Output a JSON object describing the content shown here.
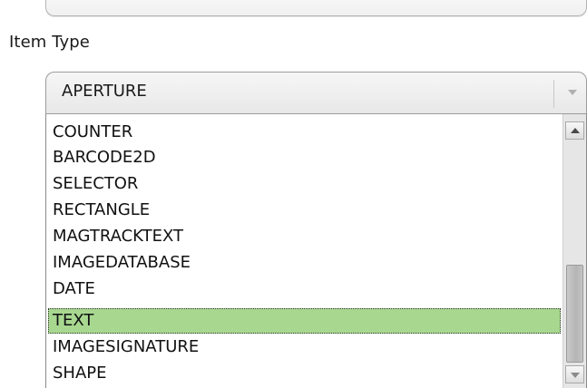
{
  "item_type": {
    "label": "Item Type",
    "selected_value": "APERTURE",
    "icons": {
      "dropdown": "chevron-down-icon",
      "scroll_up": "arrow-up-icon",
      "scroll_down": "arrow-down-icon"
    },
    "options": [
      "COUNTER",
      "BARCODE2D",
      "SELECTOR",
      "RECTANGLE",
      "MAGTRACKTEXT",
      "IMAGEDATABASE",
      "DATE",
      "TEXT",
      "IMAGESIGNATURE",
      "SHAPE"
    ],
    "highlighted_option": "TEXT"
  },
  "colors": {
    "highlight": "#a8d890",
    "border": "#9c9c9c"
  }
}
